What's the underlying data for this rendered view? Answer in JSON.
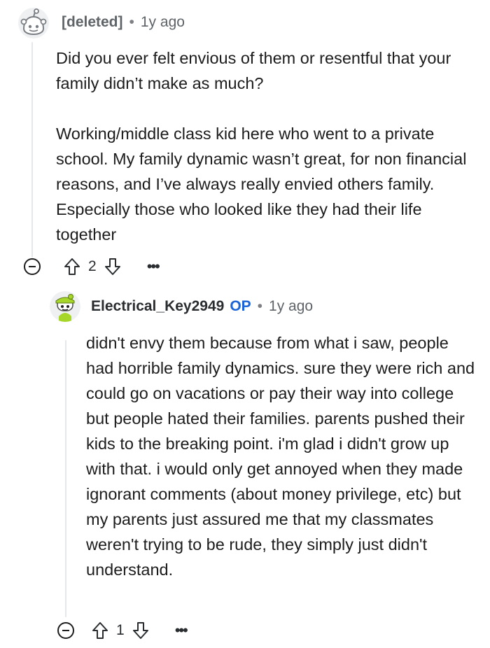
{
  "comments": [
    {
      "username": "[deleted]",
      "is_op": false,
      "time": "1y ago",
      "paragraphs": [
        "Did you ever felt envious of them or resentful that your family didn’t make as much?",
        "Working/middle class kid here who went to a private school. My family dynamic wasn’t great, for non financial reasons, and I’ve always really envied others family. Especially those who looked like they had their life together"
      ],
      "votes": "2",
      "avatar_icon": "deleted-user-avatar"
    },
    {
      "username": "Electrical_Key2949",
      "is_op": true,
      "op_label": "OP",
      "time": "1y ago",
      "paragraphs": [
        "didn't envy them because from what i saw, people had horrible family dynamics. sure they were rich and could go on vacations or pay their way into college but people hated their families. parents pushed their kids to the breaking point. i'm glad i didn't grow up with that. i would only get annoyed when they made ignorant comments (about money privilege, etc) but my parents just assured me that my classmates weren't trying to be rude, they simply just didn't understand."
      ],
      "votes": "1",
      "avatar_icon": "snoo-green-avatar"
    }
  ],
  "separator": "•",
  "more_label": "•••",
  "colors": {
    "op_badge": "#1a64d6",
    "thread_line": "#e5e7ea",
    "text": "#1c1c1c"
  }
}
